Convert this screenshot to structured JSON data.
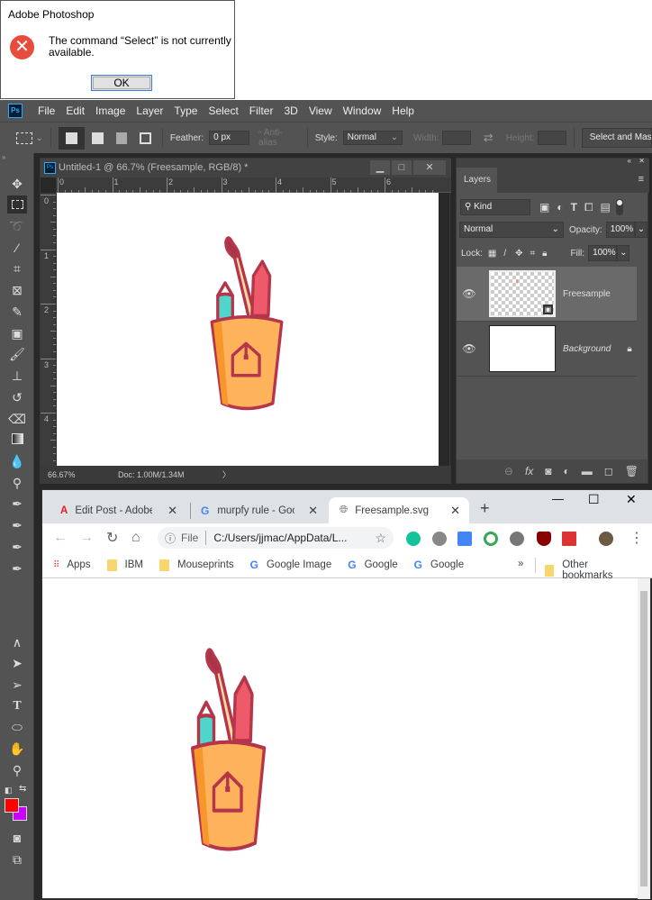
{
  "dialog": {
    "title": "Adobe Photoshop",
    "icon": "error-icon",
    "message": "The command “Select” is not currently available.",
    "ok_label": "OK"
  },
  "photoshop": {
    "menu": [
      "File",
      "Edit",
      "Image",
      "Layer",
      "Type",
      "Select",
      "Filter",
      "3D",
      "View",
      "Window",
      "Help"
    ],
    "options": {
      "feather_label": "Feather:",
      "feather_value": "0 px",
      "antialias_label": "Anti-alias",
      "style_label": "Style:",
      "style_value": "Normal",
      "width_label": "Width:",
      "height_label": "Height:",
      "select_mask_label": "Select and Mask..."
    },
    "document": {
      "title": "Untitled-1 @ 66.7% (Freesample, RGB/8) *",
      "ruler_h": [
        "0",
        "1",
        "2",
        "3",
        "4",
        "5",
        "6"
      ],
      "ruler_v": [
        "0",
        "1",
        "2",
        "3",
        "4"
      ],
      "zoom": "66.67%",
      "doc_size": "Doc: 1.00M/1.34M"
    },
    "colors": {
      "foreground": "#ff0000",
      "background": "#cc00ff"
    },
    "layers_panel": {
      "tab": "Layers",
      "filter_kind": "Kind",
      "blend_mode": "Normal",
      "opacity_label": "Opacity:",
      "opacity_value": "100%",
      "lock_label": "Lock:",
      "fill_label": "Fill:",
      "fill_value": "100%",
      "layers": [
        {
          "name": "Freesample",
          "visible": true,
          "selected": true
        },
        {
          "name": "Background",
          "visible": true,
          "locked": true
        }
      ]
    }
  },
  "chrome": {
    "tabs": [
      {
        "title": "Edit Post - Adobe Su",
        "icon": "adobe-icon"
      },
      {
        "title": "murpfy rule - Googl",
        "icon": "google-icon"
      },
      {
        "title": "Freesample.svg",
        "icon": "globe-icon",
        "active": true
      }
    ],
    "address": {
      "scheme_label": "File",
      "url": "C:/Users/jjmac/AppData/L..."
    },
    "bookmarks": [
      {
        "label": "Apps",
        "icon": "apps-icon"
      },
      {
        "label": "IBM",
        "icon": "folder-icon"
      },
      {
        "label": "Mouseprints",
        "icon": "folder-icon"
      },
      {
        "label": "Google Image",
        "icon": "google-icon"
      },
      {
        "label": "Google",
        "icon": "google-icon"
      },
      {
        "label": "Google",
        "icon": "google-icon"
      }
    ],
    "other_bookmarks": "Other bookmarks",
    "overflow": "»"
  }
}
